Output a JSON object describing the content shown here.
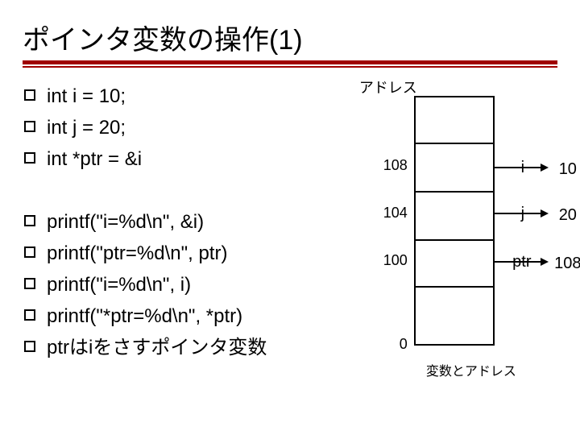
{
  "title": "ポインタ変数の操作(1)",
  "bullets_group1": [
    "int i = 10;",
    "int j = 20;",
    "int *ptr = &i"
  ],
  "bullets_group2": [
    "printf(\"i=%d\\n\", &i)",
    "printf(\"ptr=%d\\n\", ptr)",
    "printf(\"i=%d\\n\", i)",
    "printf(\"*ptr=%d\\n\", *ptr)",
    "ptrはiをさすポインタ変数"
  ],
  "memory": {
    "heading": "アドレス",
    "rows": [
      {
        "addr": "108",
        "name": "i",
        "value": "10"
      },
      {
        "addr": "104",
        "name": "j",
        "value": "20"
      },
      {
        "addr": "100",
        "name": "ptr",
        "value": "108"
      }
    ],
    "base_addr": "0",
    "caption": "変数とアドレス"
  }
}
